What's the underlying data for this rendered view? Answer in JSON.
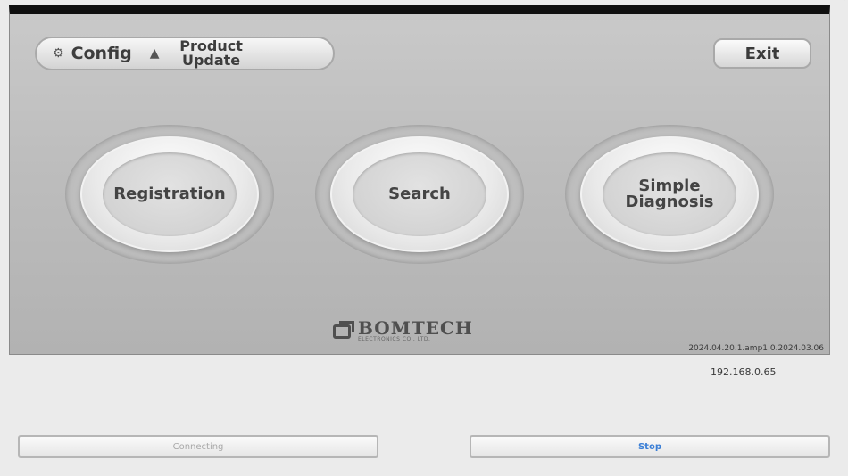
{
  "toolbar": {
    "config_label": "Config",
    "product_update_line1": "Product",
    "product_update_line2": "Update",
    "exit_label": "Exit"
  },
  "main_buttons": {
    "registration": "Registration",
    "search": "Search",
    "simple_line1": "Simple",
    "simple_line2": "Diagnosis"
  },
  "brand": {
    "name": "BOMTECH",
    "sub": "ELECTRONICS CO., LTD."
  },
  "version_text": "2024.04.20.1.amp1.0.2024.03.06",
  "ip_address": "192.168.0.65",
  "bottom": {
    "connect_label": "Connecting",
    "stop_label": "Stop"
  },
  "icons": {
    "config": "gear-icon",
    "update": "upload-icon"
  }
}
